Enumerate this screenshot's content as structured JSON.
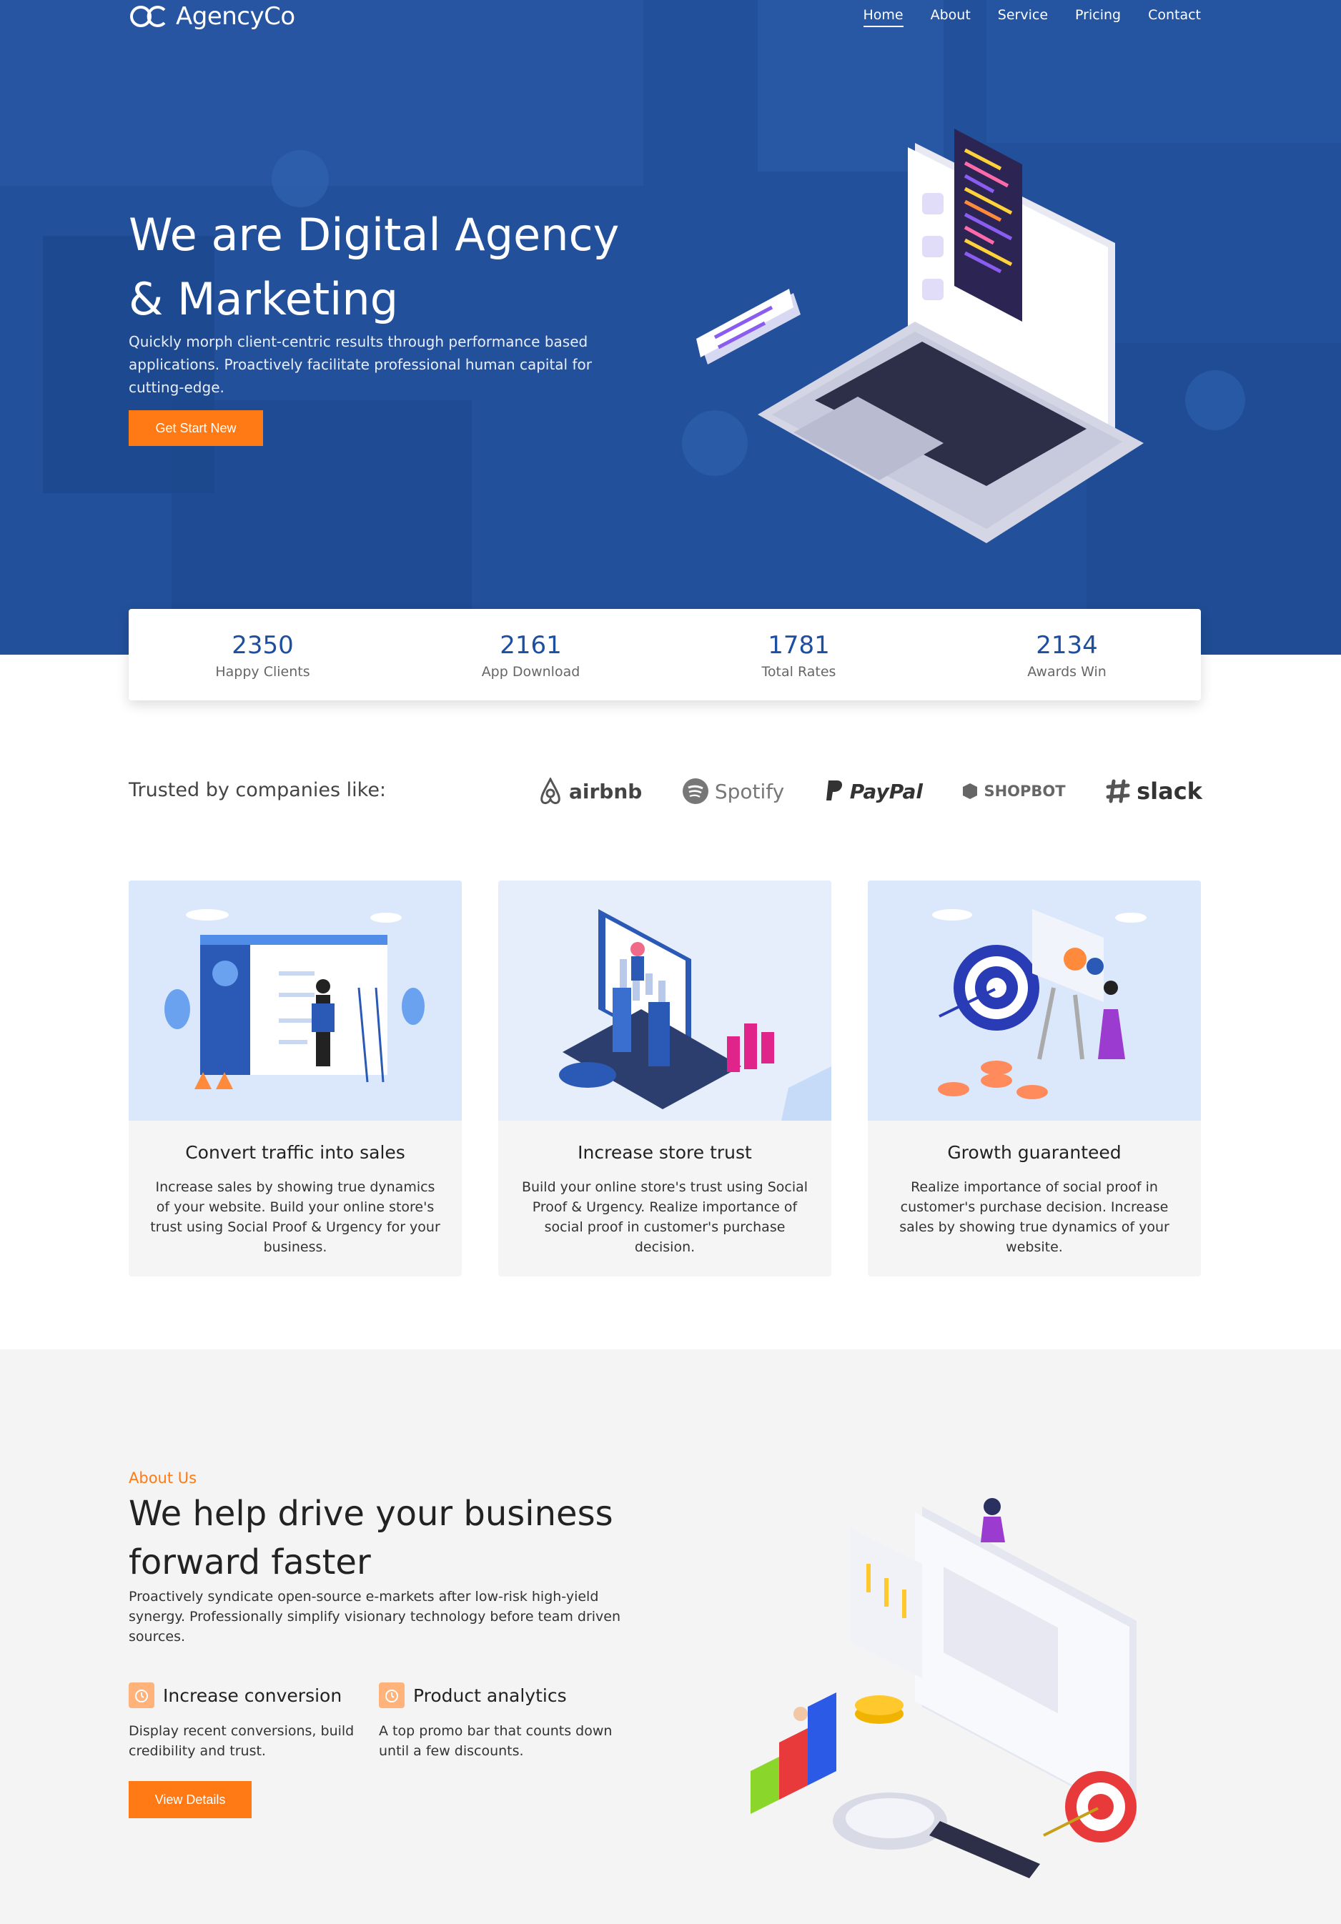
{
  "brand": {
    "name": "AgencyCo"
  },
  "nav": {
    "items": [
      {
        "label": "Home",
        "active": true
      },
      {
        "label": "About"
      },
      {
        "label": "Service"
      },
      {
        "label": "Pricing"
      },
      {
        "label": "Contact"
      }
    ]
  },
  "hero": {
    "title_line1": "We are Digital Agency",
    "title_line2": "& Marketing",
    "description": "Quickly morph client-centric results through performance based applications. Proactively facilitate professional human capital for cutting-edge.",
    "cta_label": "Get Start New"
  },
  "stats": [
    {
      "value": "2350",
      "label": "Happy Clients"
    },
    {
      "value": "2161",
      "label": "App Download"
    },
    {
      "value": "1781",
      "label": "Total Rates"
    },
    {
      "value": "2134",
      "label": "Awards Win"
    }
  ],
  "trusted": {
    "label": "Trusted by companies like:",
    "brands": [
      "airbnb",
      "Spotify",
      "PayPal",
      "SHOPBOT",
      "slack"
    ]
  },
  "cards": [
    {
      "title": "Convert traffic into sales",
      "text": "Increase sales by showing true dynamics of your website. Build your online store's trust using Social Proof & Urgency for your business."
    },
    {
      "title": "Increase store trust",
      "text": "Build your online store's trust using Social Proof & Urgency. Realize importance of social proof in customer's purchase decision."
    },
    {
      "title": "Growth guaranteed",
      "text": "Realize importance of social proof in customer's purchase decision. Increase sales by showing true dynamics of your website."
    }
  ],
  "about": {
    "kicker": "About Us",
    "title_line1": "We help drive your business",
    "title_line2": "forward faster",
    "description": "Proactively syndicate open-source e-markets after low-risk high-yield synergy. Professionally simplify visionary technology before team driven sources.",
    "features": [
      {
        "title": "Increase conversion",
        "text": "Display recent conversions, build credibility and trust."
      },
      {
        "title": "Product analytics",
        "text": "A top promo bar that counts down until a few discounts."
      }
    ],
    "cta_label": "View Details"
  },
  "colors": {
    "primary": "#1c4fa0",
    "accent": "#ff7a14",
    "hero_bg": "#214f99"
  }
}
